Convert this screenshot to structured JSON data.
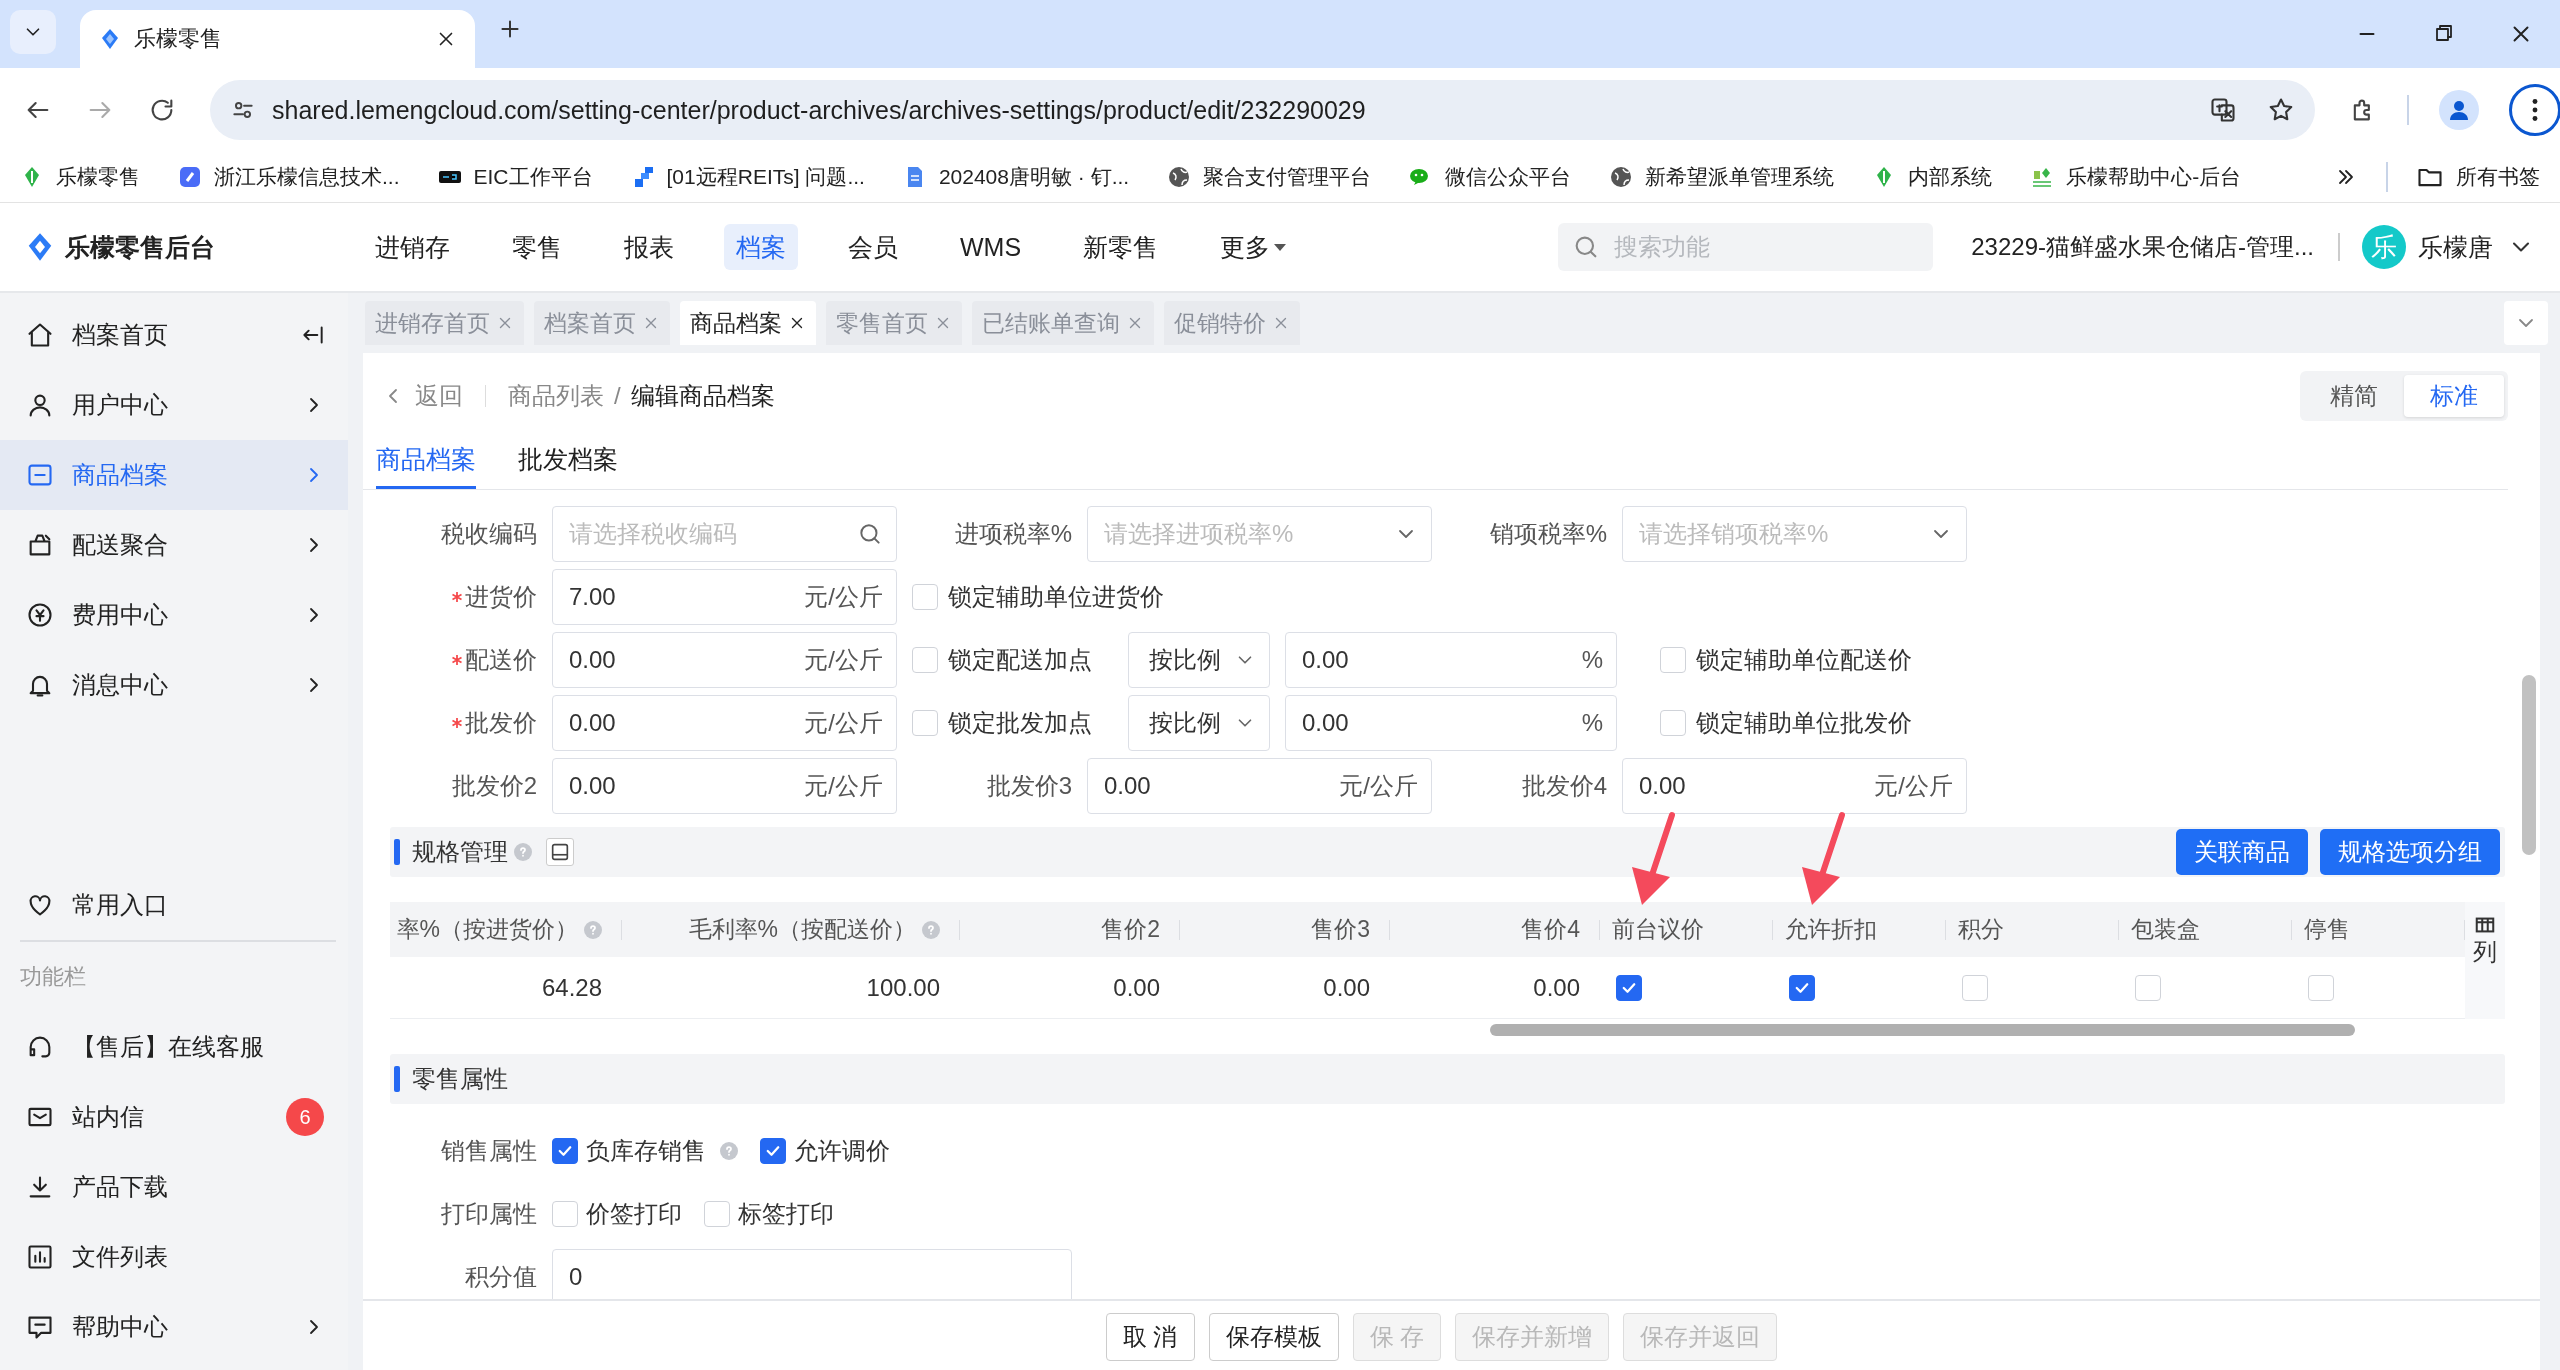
{
  "browser": {
    "tabs": [
      {
        "title": "乐檬零售",
        "selected": true
      }
    ],
    "url": "shared.lemengcloud.com/setting-center/product-archives/archives-settings/product/edit/232290029",
    "bookmarks": [
      "乐檬零售",
      "浙江乐檬信息技术...",
      "EIC工作平台",
      "[01远程REITs] 问题...",
      "202408唐明敏 · 钉...",
      "聚合支付管理平台",
      "微信公众平台",
      "新希望派单管理系统",
      "内部系统",
      "乐檬帮助中心-后台"
    ],
    "all_bookmarks": "所有书签"
  },
  "header": {
    "title": "乐檬零售后台",
    "nav": [
      {
        "label": "进销存",
        "selected": false,
        "kind": "link"
      },
      {
        "label": "零售",
        "selected": false,
        "kind": "link"
      },
      {
        "label": "报表",
        "selected": false,
        "kind": "link"
      },
      {
        "label": "档案",
        "selected": true,
        "kind": "link"
      },
      {
        "label": "会员",
        "selected": false,
        "kind": "link"
      },
      {
        "label": "WMS",
        "selected": false,
        "kind": "link"
      },
      {
        "label": "新零售",
        "selected": false,
        "kind": "link"
      },
      {
        "label": "更多",
        "selected": false,
        "kind": "dropdown"
      }
    ],
    "search": {
      "placeholder": "搜索功能"
    },
    "store": "23229-猫鲜盛水果仓储店-管理...",
    "user": {
      "avatar": "乐",
      "name": "乐檬唐"
    }
  },
  "sidebar": {
    "items": [
      {
        "label": "档案首页",
        "selected": false,
        "expandable": false
      },
      {
        "label": "用户中心",
        "selected": false,
        "expandable": true
      },
      {
        "label": "商品档案",
        "selected": true,
        "expandable": true
      },
      {
        "label": "配送聚合",
        "selected": false,
        "expandable": true
      },
      {
        "label": "费用中心",
        "selected": false,
        "expandable": true
      },
      {
        "label": "消息中心",
        "selected": false,
        "expandable": true
      }
    ],
    "favorites": "常用入口",
    "section_title": "功能栏",
    "tools": [
      {
        "label": "【售后】在线客服",
        "expandable": false
      },
      {
        "label": "站内信",
        "badge": "6",
        "expandable": false
      },
      {
        "label": "产品下载",
        "expandable": false
      },
      {
        "label": "文件列表",
        "expandable": false
      },
      {
        "label": "帮助中心",
        "expandable": true
      }
    ]
  },
  "page_tabs": [
    {
      "label": "进销存首页",
      "selected": false
    },
    {
      "label": "档案首页",
      "selected": false
    },
    {
      "label": "商品档案",
      "selected": true
    },
    {
      "label": "零售首页",
      "selected": false
    },
    {
      "label": "已结账单查询",
      "selected": false
    },
    {
      "label": "促销特价",
      "selected": false
    }
  ],
  "breadcrumb": {
    "back": "返回",
    "items": [
      "商品列表",
      "编辑商品档案"
    ],
    "separator": "/"
  },
  "view_modes": [
    {
      "label": "精简",
      "selected": false
    },
    {
      "label": "标准",
      "selected": true
    }
  ],
  "sub_tabs": [
    {
      "label": "商品档案",
      "selected": true
    },
    {
      "label": "批发档案",
      "selected": false
    }
  ],
  "form_rows": [
    [
      {
        "kind": "search",
        "label": "税收编码",
        "placeholder": "请选择税收编码",
        "required": false
      },
      {
        "kind": "select",
        "label": "进项税率%",
        "placeholder": "请选择进项税率%",
        "required": false
      },
      {
        "kind": "select",
        "label": "销项税率%",
        "placeholder": "请选择销项税率%",
        "required": false
      }
    ],
    [
      {
        "kind": "price",
        "label": "进货价",
        "value": "7.00",
        "unit": "元/公斤",
        "required": true
      },
      {
        "kind": "check",
        "label": "锁定辅助单位进货价",
        "checked": false
      }
    ],
    [
      {
        "kind": "price",
        "label": "配送价",
        "value": "0.00",
        "unit": "元/公斤",
        "required": true
      },
      {
        "kind": "check",
        "label": "锁定配送加点",
        "checked": false
      },
      {
        "kind": "mode",
        "value": "按比例"
      },
      {
        "kind": "percent",
        "value": "0.00",
        "unit": "%"
      },
      {
        "kind": "check",
        "label": "锁定辅助单位配送价",
        "checked": false
      }
    ],
    [
      {
        "kind": "price",
        "label": "批发价",
        "value": "0.00",
        "unit": "元/公斤",
        "required": true
      },
      {
        "kind": "check",
        "label": "锁定批发加点",
        "checked": false
      },
      {
        "kind": "mode",
        "value": "按比例"
      },
      {
        "kind": "percent",
        "value": "0.00",
        "unit": "%"
      },
      {
        "kind": "check",
        "label": "锁定辅助单位批发价",
        "checked": false
      }
    ],
    [
      {
        "kind": "price",
        "label": "批发价2",
        "value": "0.00",
        "unit": "元/公斤",
        "required": false
      },
      {
        "kind": "price",
        "label": "批发价3",
        "value": "0.00",
        "unit": "元/公斤",
        "required": false
      },
      {
        "kind": "price",
        "label": "批发价4",
        "value": "0.00",
        "unit": "元/公斤",
        "required": false
      }
    ]
  ],
  "spec": {
    "title": "规格管理",
    "buttons": [
      "关联商品",
      "规格选项分组"
    ],
    "columns": [
      {
        "label": "率%（按进货价）",
        "kind": "number",
        "help": true
      },
      {
        "label": "毛利率%（按配送价）",
        "kind": "number",
        "help": true
      },
      {
        "label": "售价2",
        "kind": "number",
        "help": false
      },
      {
        "label": "售价3",
        "kind": "number",
        "help": false
      },
      {
        "label": "售价4",
        "kind": "number",
        "help": false
      },
      {
        "label": "前台议价",
        "kind": "checkbox",
        "help": false
      },
      {
        "label": "允许折扣",
        "kind": "checkbox",
        "help": false
      },
      {
        "label": "积分",
        "kind": "checkbox",
        "help": false
      },
      {
        "label": "包装盒",
        "kind": "checkbox",
        "help": false
      },
      {
        "label": "停售",
        "kind": "checkbox",
        "help": false
      }
    ],
    "rows": [
      {
        "cells": [
          {
            "text": "64.28"
          },
          {
            "text": "100.00"
          },
          {
            "text": "0.00"
          },
          {
            "text": "0.00"
          },
          {
            "text": "0.00"
          },
          {
            "checked": true
          },
          {
            "checked": true
          },
          {
            "checked": false
          },
          {
            "checked": false
          },
          {
            "checked": false
          }
        ]
      }
    ],
    "column_settings": "列"
  },
  "retail": {
    "title": "零售属性",
    "rows": [
      {
        "kind": "options",
        "label": "销售属性",
        "options": [
          {
            "label": "负库存销售",
            "checked": true,
            "help": true
          },
          {
            "label": "允许调价",
            "checked": true,
            "help": false
          }
        ]
      },
      {
        "kind": "options",
        "label": "打印属性",
        "options": [
          {
            "label": "价签打印",
            "checked": false,
            "help": false
          },
          {
            "label": "标签打印",
            "checked": false,
            "help": false
          }
        ]
      },
      {
        "kind": "input",
        "label": "积分值",
        "value": "0"
      }
    ]
  },
  "footer": {
    "buttons": [
      {
        "label": "取 消",
        "disabled": false
      },
      {
        "label": "保存模板",
        "disabled": false
      },
      {
        "label": "保 存",
        "disabled": true
      },
      {
        "label": "保存并新增",
        "disabled": true
      },
      {
        "label": "保存并返回",
        "disabled": true
      }
    ]
  }
}
